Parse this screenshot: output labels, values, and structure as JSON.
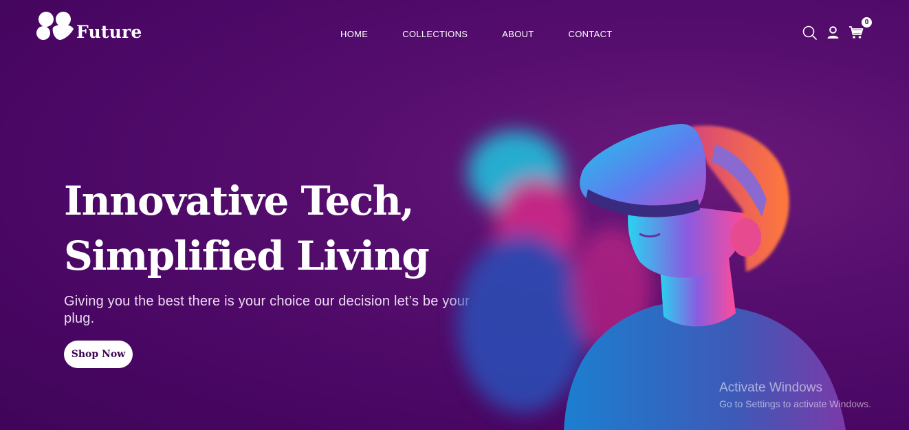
{
  "brand": {
    "name": "Future",
    "logo_icon": "clover-logo-icon"
  },
  "nav": {
    "items": [
      {
        "label": "HOME"
      },
      {
        "label": "COLLECTIONS"
      },
      {
        "label": "ABOUT"
      },
      {
        "label": "CONTACT"
      }
    ]
  },
  "header_icons": {
    "search": "search-icon",
    "account": "user-icon",
    "cart": "cart-icon",
    "cart_count": "0"
  },
  "hero": {
    "title_line1": "Innovative Tech,",
    "title_line2": "Simplified Living",
    "subtitle": "Giving you the best there is your choice our decision let’s be your plug.",
    "cta_label": "Shop Now"
  },
  "watermark": {
    "line1": "Activate Windows",
    "line2": "Go to Settings to activate Windows."
  },
  "colors": {
    "background": "#4a0764",
    "accent_pink": "#ff2a8a",
    "accent_cyan": "#1fd6e0",
    "text": "#ffffff"
  }
}
